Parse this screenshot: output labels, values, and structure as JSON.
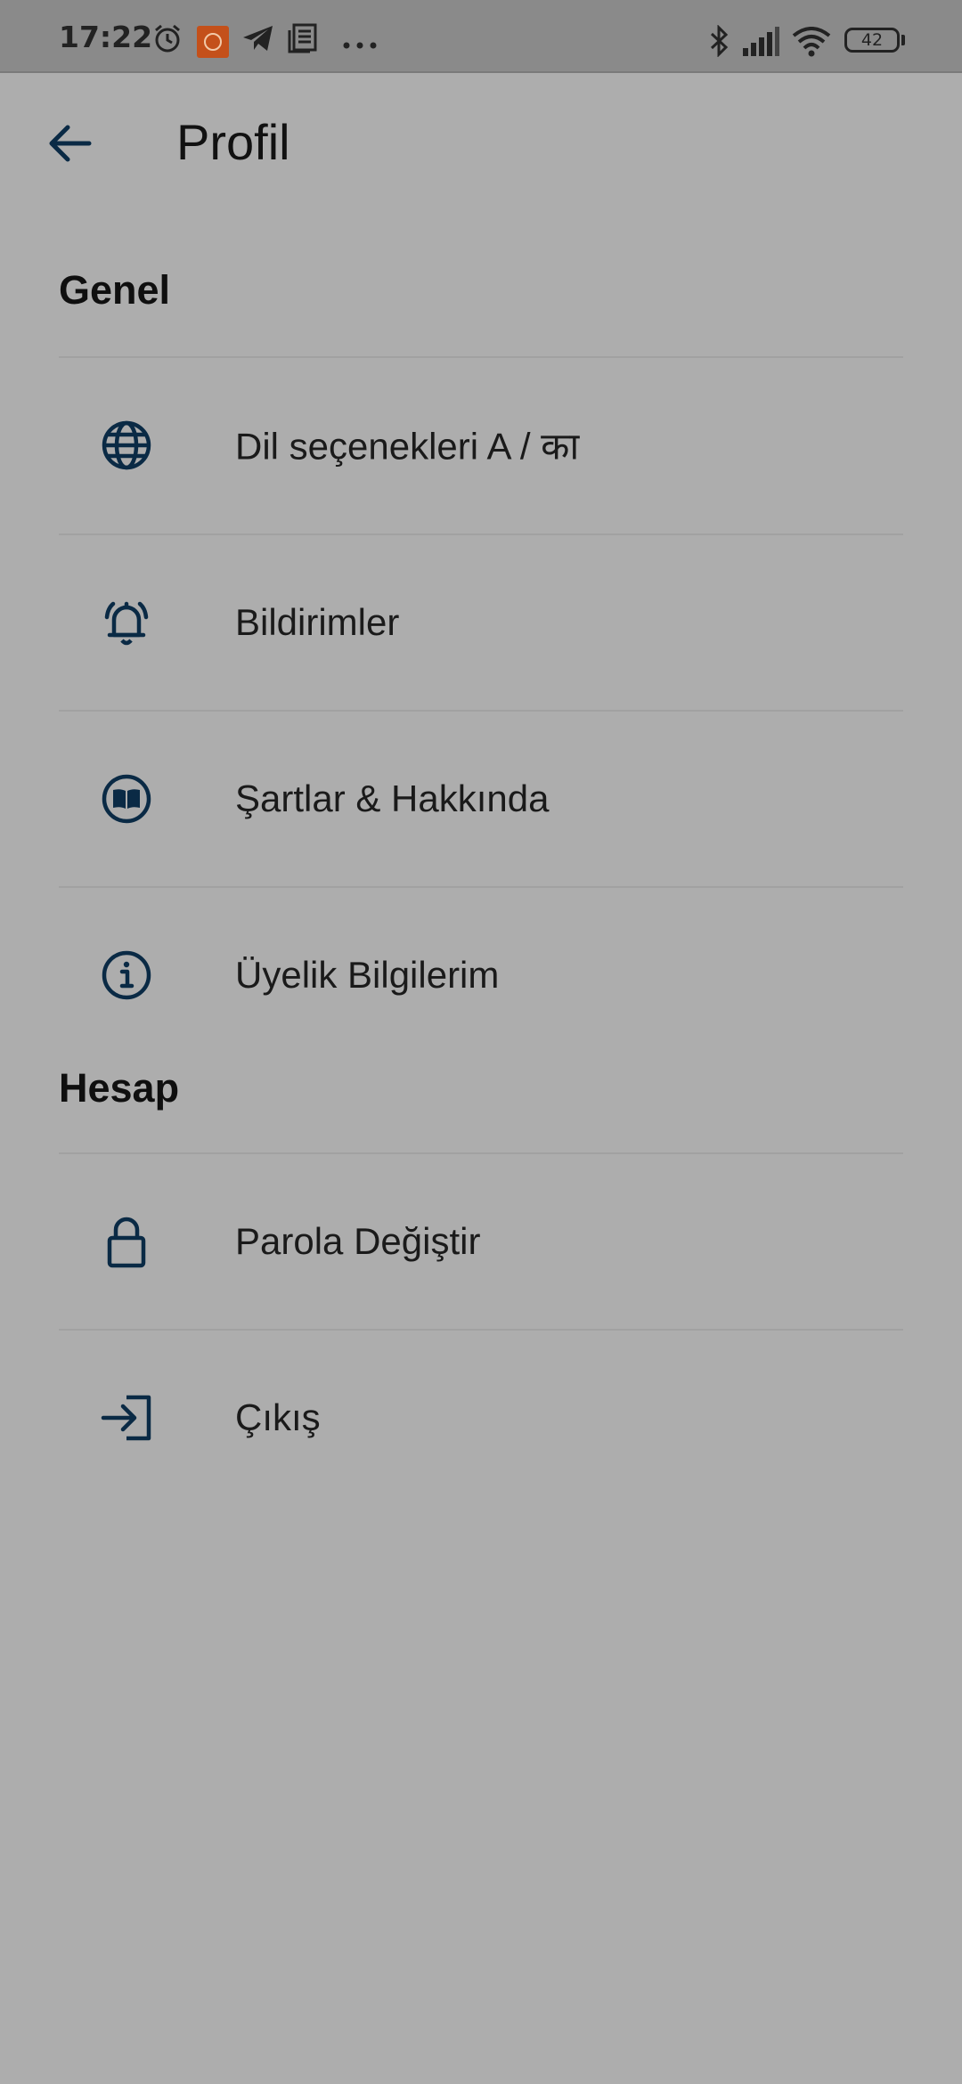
{
  "status_bar": {
    "time": "17:22",
    "battery": "42",
    "icons": [
      "alarm-icon",
      "app-notification-icon",
      "telegram-icon",
      "news-icon",
      "more-dots-icon",
      "bluetooth-icon",
      "signal-icon",
      "wifi-icon",
      "battery-icon"
    ]
  },
  "header": {
    "back_icon": "arrow-left-icon",
    "title": "Profil"
  },
  "sections": [
    {
      "title": "Genel",
      "items": [
        {
          "label": "Dil seçenekleri A / का",
          "icon": "globe-icon"
        },
        {
          "label": "Bildirimler",
          "icon": "bell-ringing-icon"
        },
        {
          "label": "Şartlar & Hakkında",
          "icon": "book-icon"
        },
        {
          "label": "Üyelik Bilgilerim",
          "icon": "info-icon"
        }
      ]
    },
    {
      "title": "Hesap",
      "items": [
        {
          "label": "Parola Değiştir",
          "icon": "lock-icon"
        },
        {
          "label": "Çıkış",
          "icon": "logout-icon"
        }
      ]
    }
  ],
  "colors": {
    "background": "#adadad",
    "status_bar": "#8a8a8a",
    "icon": "#0a2a45",
    "text": "#1a1a1a",
    "divider": "#a1a1a1"
  }
}
